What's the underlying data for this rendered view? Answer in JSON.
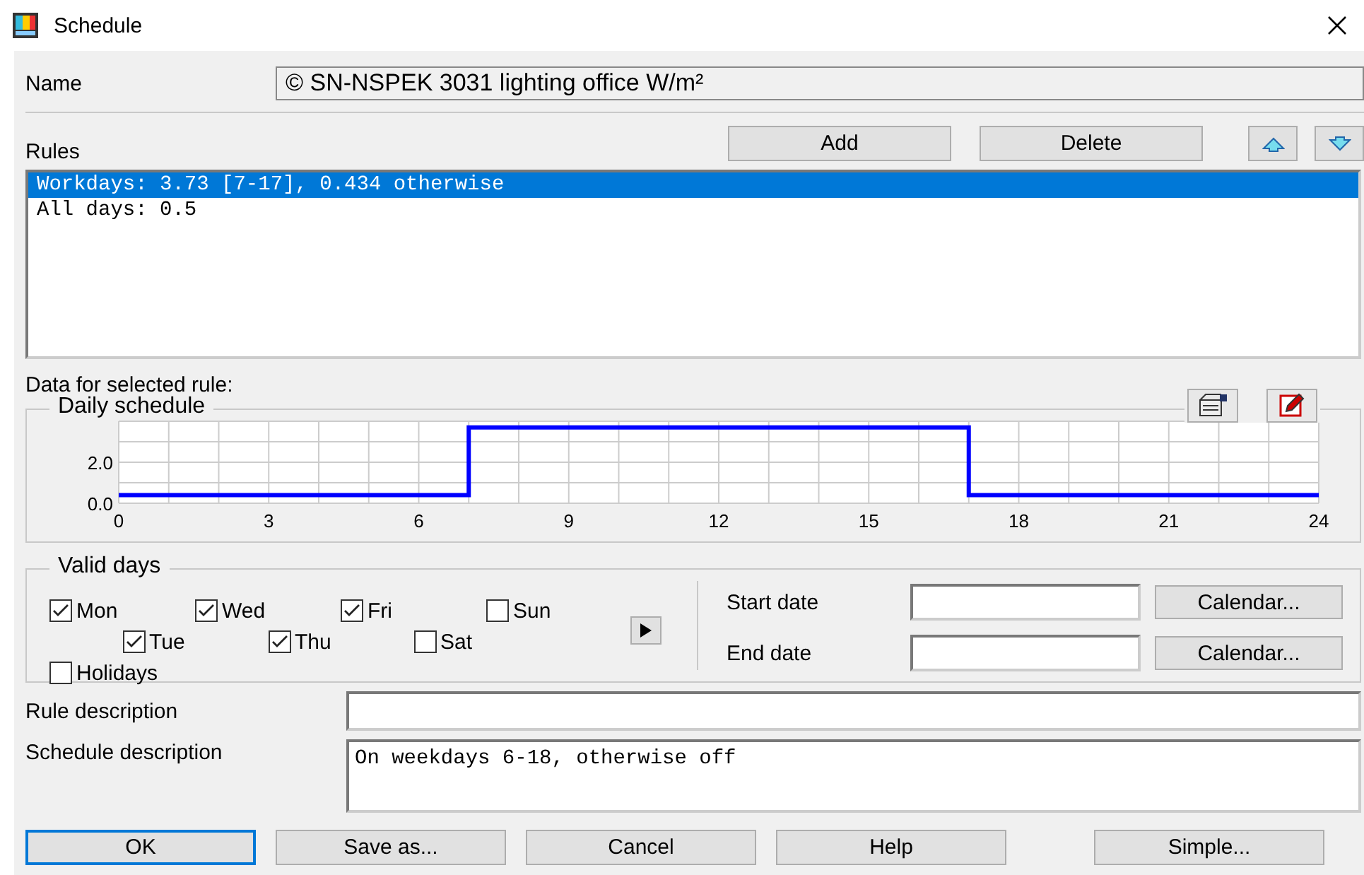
{
  "window": {
    "title": "Schedule"
  },
  "name": {
    "label": "Name",
    "value": "© SN-NSPEK 3031 lighting office W/m²"
  },
  "rules": {
    "label": "Rules",
    "buttons": [
      "Add",
      "Delete"
    ],
    "items": [
      {
        "text": "Workdays: 3.73 [7-17], 0.434 otherwise",
        "selected": true
      },
      {
        "text": "All days: 0.5",
        "selected": false
      }
    ]
  },
  "data_heading": "Data for selected rule:",
  "daily_schedule": {
    "title": "Daily schedule",
    "chart_data": {
      "type": "line",
      "x": [
        0,
        7,
        7,
        17,
        17,
        24
      ],
      "series": [
        {
          "color": "#0000ff",
          "values": [
            0.4,
            0.4,
            3.7,
            3.7,
            0.4,
            0.4
          ]
        }
      ],
      "grid": true,
      "xlim": [
        0,
        24
      ],
      "ylim": [
        0,
        4
      ],
      "xticks": [
        0,
        3,
        6,
        9,
        12,
        15,
        18,
        21,
        24
      ],
      "yticks": [
        {
          "value": 0,
          "label": "0.0"
        },
        {
          "value": 2,
          "label": "2.0"
        }
      ]
    }
  },
  "valid_days": {
    "title": "Valid days",
    "days": [
      {
        "label": "Mon",
        "checked": true
      },
      {
        "label": "Wed",
        "checked": true
      },
      {
        "label": "Fri",
        "checked": true
      },
      {
        "label": "Sun",
        "checked": false
      },
      {
        "label": "Tue",
        "checked": true
      },
      {
        "label": "Thu",
        "checked": true
      },
      {
        "label": "Sat",
        "checked": false
      },
      {
        "label": "Holidays",
        "checked": false
      }
    ]
  },
  "dates": [
    {
      "label": "Start date",
      "button": "Calendar..."
    },
    {
      "label": "End date",
      "button": "Calendar..."
    }
  ],
  "rule_description": {
    "label": "Rule description"
  },
  "schedule_description": {
    "label": "Schedule description",
    "value": "On weekdays 6-18, otherwise off"
  },
  "buttons": [
    {
      "label": "OK",
      "focused": true
    },
    {
      "label": "Save as...",
      "focused": false
    },
    {
      "label": "Cancel",
      "focused": false
    },
    {
      "label": "Help",
      "focused": false
    },
    {
      "label": "Simple...",
      "focused": false
    }
  ]
}
